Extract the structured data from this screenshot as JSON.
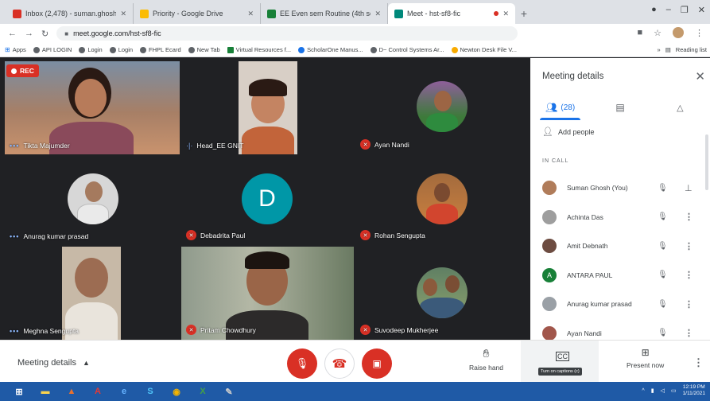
{
  "browser": {
    "tabs": [
      {
        "title": "Inbox (2,478) - suman.ghosh@g",
        "favicon_color": "#d93025"
      },
      {
        "title": "Priority - Google Drive",
        "favicon_color": "#fbbc04"
      },
      {
        "title": "EE Even sem Routine (4th sem ...",
        "favicon_color": "#188038"
      },
      {
        "title": "Meet - hst-sf8-fic",
        "favicon_color": "#00897b"
      }
    ],
    "url": "meet.google.com/hst-sf8-fic",
    "bookmarks": [
      "Apps",
      "API LOGIN",
      "Login",
      "Login",
      "FHPL Ecard",
      "New Tab",
      "Virtual Resources f...",
      "ScholarOne Manus...",
      "D~ Control Systems Ar...",
      "Newton Desk File V..."
    ],
    "reading_list": "Reading list"
  },
  "meeting": {
    "rec_label": "REC",
    "tiles": [
      {
        "name": "Tikta Majumder",
        "status": "dots"
      },
      {
        "name": "Head_EE GNIT",
        "status": "speaking"
      },
      {
        "name": "Ayan Nandi",
        "status": "muted"
      },
      {
        "name": "Anurag kumar prasad",
        "status": "dots"
      },
      {
        "name": "Debadrita Paul",
        "status": "muted",
        "initial": "D"
      },
      {
        "name": "Rohan Sengupta",
        "status": "muted"
      },
      {
        "name": "Meghna Sengupta",
        "status": "dots"
      },
      {
        "name": "Pritam Chowdhury",
        "status": "muted"
      },
      {
        "name": "Suvodeep Mukherjee",
        "status": "muted"
      }
    ]
  },
  "panel": {
    "title": "Meeting details",
    "people_count": "(28)",
    "add_people": "Add people",
    "in_call_label": "IN CALL",
    "people": [
      {
        "name": "Suman Ghosh (You)",
        "avatar_color": "#b07c5a",
        "initial": ""
      },
      {
        "name": "Achinta Das",
        "avatar_color": "#9e9e9e",
        "initial": ""
      },
      {
        "name": "Amit Debnath",
        "avatar_color": "#6d4c41",
        "initial": ""
      },
      {
        "name": "ANTARA PAUL",
        "avatar_color": "#188038",
        "initial": "A"
      },
      {
        "name": "Anurag kumar prasad",
        "avatar_color": "#9aa0a6",
        "initial": ""
      },
      {
        "name": "Ayan Nandi",
        "avatar_color": "#a1564b",
        "initial": ""
      }
    ]
  },
  "controls": {
    "meeting_details": "Meeting details",
    "raise_hand": "Raise hand",
    "captions_tooltip": "Turn on captions (c)",
    "present_now": "Present now"
  },
  "taskbar": {
    "time": "12:19 PM",
    "date": "1/11/2021"
  }
}
